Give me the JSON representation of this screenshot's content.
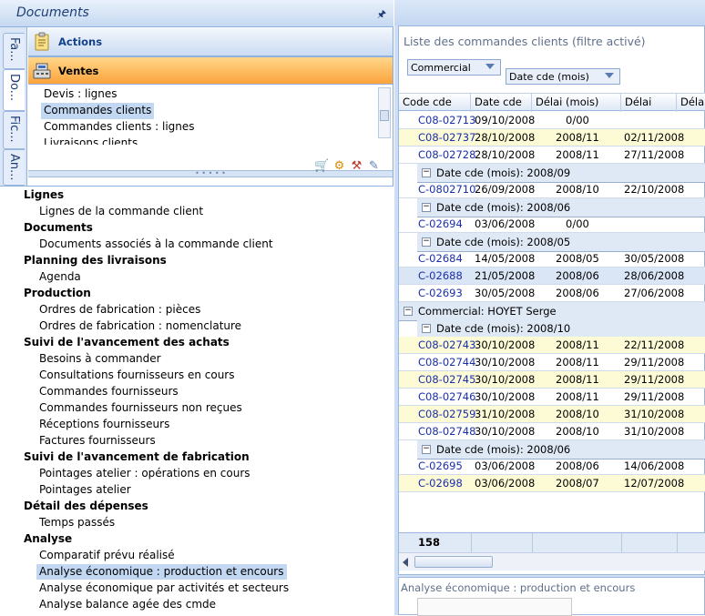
{
  "documents_panel": {
    "title": "Documents",
    "pin_icon": "pin-icon",
    "side_tabs": [
      "Fa...",
      "Do...",
      "Fic...",
      "An..."
    ],
    "active_side_tab": 1
  },
  "groups": {
    "actions": {
      "label": "Actions",
      "icon": "clipboard-icon"
    },
    "ventes": {
      "label": "Ventes",
      "icon": "cash-register-icon"
    }
  },
  "ventes_items": [
    "Devis : lignes",
    "Commandes clients",
    "Commandes clients : lignes",
    "Livraisons clients"
  ],
  "ventes_selected": 1,
  "tree": [
    {
      "category": "Lignes",
      "items": [
        "Lignes de la commande client"
      ]
    },
    {
      "category": "Documents",
      "items": [
        "Documents associés à la commande client"
      ]
    },
    {
      "category": "Planning des livraisons",
      "items": [
        "Agenda"
      ]
    },
    {
      "category": "Production",
      "items": [
        "Ordres de fabrication : pièces",
        "Ordres de fabrication : nomenclature"
      ]
    },
    {
      "category": "Suivi de l'avancement des achats",
      "items": [
        "Besoins à commander",
        "Consultations fournisseurs en cours",
        "Commandes fournisseurs",
        "Commandes fournisseurs non reçues",
        "Réceptions fournisseurs",
        "Factures fournisseurs"
      ]
    },
    {
      "category": "Suivi de l'avancement de fabrication",
      "items": [
        "Pointages atelier : opérations en cours",
        "Pointages atelier"
      ]
    },
    {
      "category": "Détail des dépenses",
      "items": [
        "Temps passés"
      ]
    },
    {
      "category": "Analyse",
      "items": [
        "Comparatif prévu réalisé",
        "Analyse économique : production et encours",
        "Analyse économique par activités et secteurs",
        "Analyse balance agée des cmde"
      ]
    }
  ],
  "tree_selected": "Analyse économique : production et encours",
  "main": {
    "title": "Liste des commandes clients (filtre activé)",
    "group_by_1": "Commercial",
    "group_by_2": "Date cde (mois)",
    "columns": [
      "Code cde",
      "Date cde",
      "Délai (mois)",
      "Délai",
      "Délai (m"
    ],
    "rows": [
      {
        "type": "row",
        "style": "white",
        "code": "C08-02713",
        "date": "09/10/2008",
        "delai_mois": "0/00",
        "delai": ""
      },
      {
        "type": "row",
        "style": "yellow",
        "code": "C08-02737",
        "date": "28/10/2008",
        "delai_mois": "2008/11",
        "delai": "02/11/2008"
      },
      {
        "type": "row",
        "style": "white",
        "code": "C08-02728",
        "date": "28/10/2008",
        "delai_mois": "2008/11",
        "delai": "27/11/2008"
      },
      {
        "type": "group2",
        "label": "Date cde (mois): 2008/09"
      },
      {
        "type": "row",
        "style": "white",
        "code": "C-0802710",
        "date": "26/09/2008",
        "delai_mois": "2008/10",
        "delai": "22/10/2008"
      },
      {
        "type": "group2",
        "label": "Date cde (mois): 2008/06"
      },
      {
        "type": "row",
        "style": "white",
        "code": "C-02694",
        "date": "03/06/2008",
        "delai_mois": "0/00",
        "delai": ""
      },
      {
        "type": "group2",
        "label": "Date cde (mois): 2008/05"
      },
      {
        "type": "row",
        "style": "white",
        "code": "C-02684",
        "date": "14/05/2008",
        "delai_mois": "2008/05",
        "delai": "30/05/2008"
      },
      {
        "type": "row",
        "style": "blue",
        "code": "C-02688",
        "date": "21/05/2008",
        "delai_mois": "2008/06",
        "delai": "28/06/2008"
      },
      {
        "type": "row",
        "style": "white",
        "code": "C-02693",
        "date": "30/05/2008",
        "delai_mois": "2008/06",
        "delai": "27/06/2008"
      },
      {
        "type": "group1",
        "label": "Commercial: HOYET Serge"
      },
      {
        "type": "group2",
        "label": "Date cde (mois): 2008/10"
      },
      {
        "type": "row",
        "style": "yellow",
        "code": "C08-02743",
        "date": "30/10/2008",
        "delai_mois": "2008/11",
        "delai": "22/11/2008"
      },
      {
        "type": "row",
        "style": "white",
        "code": "C08-02744",
        "date": "30/10/2008",
        "delai_mois": "2008/11",
        "delai": "29/11/2008"
      },
      {
        "type": "row",
        "style": "yellow",
        "code": "C08-02745",
        "date": "30/10/2008",
        "delai_mois": "2008/11",
        "delai": "29/11/2008"
      },
      {
        "type": "row",
        "style": "white",
        "code": "C08-02746",
        "date": "30/10/2008",
        "delai_mois": "2008/11",
        "delai": "29/11/2008"
      },
      {
        "type": "row",
        "style": "yellow",
        "code": "C08-02759",
        "date": "31/10/2008",
        "delai_mois": "2008/10",
        "delai": "31/10/2008"
      },
      {
        "type": "row",
        "style": "white",
        "code": "C08-02748",
        "date": "30/10/2008",
        "delai_mois": "2008/10",
        "delai": "31/10/2008"
      },
      {
        "type": "group2",
        "label": "Date cde (mois): 2008/06"
      },
      {
        "type": "row",
        "style": "white",
        "code": "C-02695",
        "date": "03/06/2008",
        "delai_mois": "2008/06",
        "delai": "14/06/2008"
      },
      {
        "type": "row",
        "style": "yellow",
        "code": "C-02698",
        "date": "03/06/2008",
        "delai_mois": "2008/07",
        "delai": "12/07/2008"
      }
    ],
    "footer_count": "158"
  },
  "preview": {
    "title": "Analyse économique : production et encours"
  },
  "colors": {
    "accent_orange": "#fba33c",
    "header_blue": "#c6d9f1",
    "selection": "#c2d8f2",
    "row_yellow": "#fdfbd6",
    "row_blue": "#dae6f6",
    "code_blue": "#1a2fa8"
  }
}
